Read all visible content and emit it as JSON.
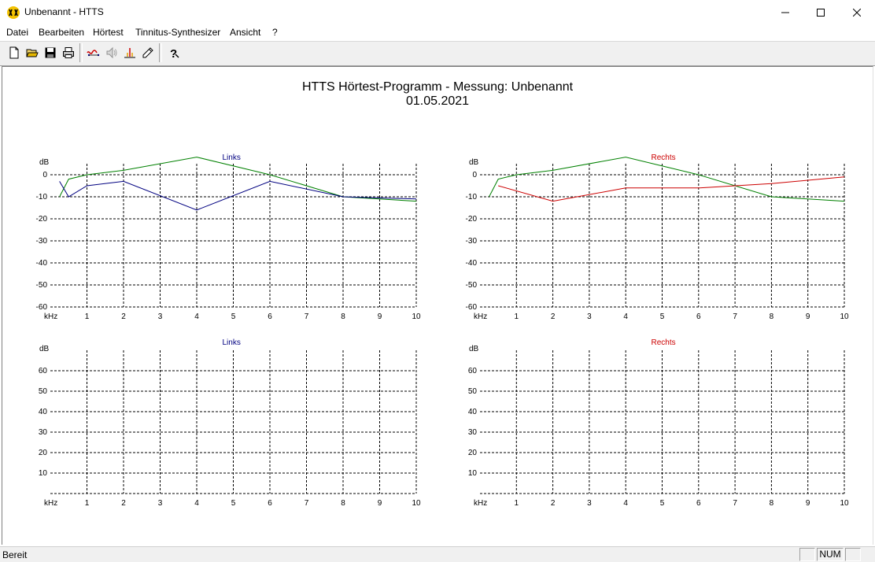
{
  "window": {
    "title": "Unbenannt - HTTS",
    "icon": "htts-app-icon"
  },
  "menu": {
    "items": [
      "Datei",
      "Bearbeiten",
      "Hörtest",
      "Tinnitus-Synthesizer",
      "Ansicht",
      "?"
    ]
  },
  "toolbar": {
    "buttons": [
      "new-file-icon",
      "open-folder-icon",
      "save-disk-icon",
      "print-icon",
      "hearing-test-icon",
      "speaker-icon",
      "tinnitus-spectrum-icon",
      "pencil-icon",
      "help-icon"
    ]
  },
  "document": {
    "title": "HTTS Hörtest-Programm  -  Messung: Unbenannt",
    "date": "01.05.2021"
  },
  "colors": {
    "left_series": "#000080",
    "right_series": "#cc0000",
    "green_series": "#008000"
  },
  "chart_data": [
    {
      "type": "line",
      "title": "Links",
      "ylabel": "dB",
      "xlabel": "kHz",
      "x_ticks": [
        "1",
        "2",
        "3",
        "4",
        "5",
        "6",
        "7",
        "8",
        "9",
        "10"
      ],
      "y_ticks": [
        "0",
        "-10",
        "-20",
        "-30",
        "-40",
        "-50",
        "-60"
      ],
      "xlim": [
        0,
        10
      ],
      "ylim": [
        -60,
        5
      ],
      "grid": true,
      "series": [
        {
          "color": "green",
          "x": [
            0.25,
            0.5,
            1,
            2,
            4,
            6,
            8,
            10
          ],
          "y": [
            -10,
            -2,
            0,
            2,
            8,
            0,
            -10,
            -12
          ]
        },
        {
          "color": "left",
          "x": [
            0.25,
            0.5,
            1,
            2,
            4,
            6,
            8,
            10
          ],
          "y": [
            -3,
            -10,
            -5,
            -3,
            -16,
            -3,
            -10,
            -11
          ]
        }
      ]
    },
    {
      "type": "line",
      "title": "Rechts",
      "ylabel": "dB",
      "xlabel": "kHz",
      "x_ticks": [
        "1",
        "2",
        "3",
        "4",
        "5",
        "6",
        "7",
        "8",
        "9",
        "10"
      ],
      "y_ticks": [
        "0",
        "-10",
        "-20",
        "-30",
        "-40",
        "-50",
        "-60"
      ],
      "xlim": [
        0,
        10
      ],
      "ylim": [
        -60,
        5
      ],
      "grid": true,
      "series": [
        {
          "color": "green",
          "x": [
            0.25,
            0.5,
            1,
            2,
            4,
            6,
            8,
            10
          ],
          "y": [
            -10,
            -2,
            0,
            2,
            8,
            0,
            -10,
            -12
          ]
        },
        {
          "color": "right",
          "x": [
            0.5,
            2,
            4,
            6,
            8,
            10
          ],
          "y": [
            -5,
            -12,
            -6,
            -6,
            -4,
            -1
          ]
        }
      ]
    },
    {
      "type": "line",
      "title": "Links",
      "ylabel": "dB",
      "xlabel": "kHz",
      "x_ticks": [
        "1",
        "2",
        "3",
        "4",
        "5",
        "6",
        "7",
        "8",
        "9",
        "10"
      ],
      "y_ticks": [
        "60",
        "50",
        "40",
        "30",
        "20",
        "10"
      ],
      "xlim": [
        0,
        10
      ],
      "ylim": [
        0,
        70
      ],
      "grid": true,
      "series": []
    },
    {
      "type": "line",
      "title": "Rechts",
      "ylabel": "dB",
      "xlabel": "kHz",
      "x_ticks": [
        "1",
        "2",
        "3",
        "4",
        "5",
        "6",
        "7",
        "8",
        "9",
        "10"
      ],
      "y_ticks": [
        "60",
        "50",
        "40",
        "30",
        "20",
        "10"
      ],
      "xlim": [
        0,
        10
      ],
      "ylim": [
        0,
        70
      ],
      "grid": true,
      "series": []
    }
  ],
  "status": {
    "text": "Bereit",
    "num": "NUM"
  }
}
